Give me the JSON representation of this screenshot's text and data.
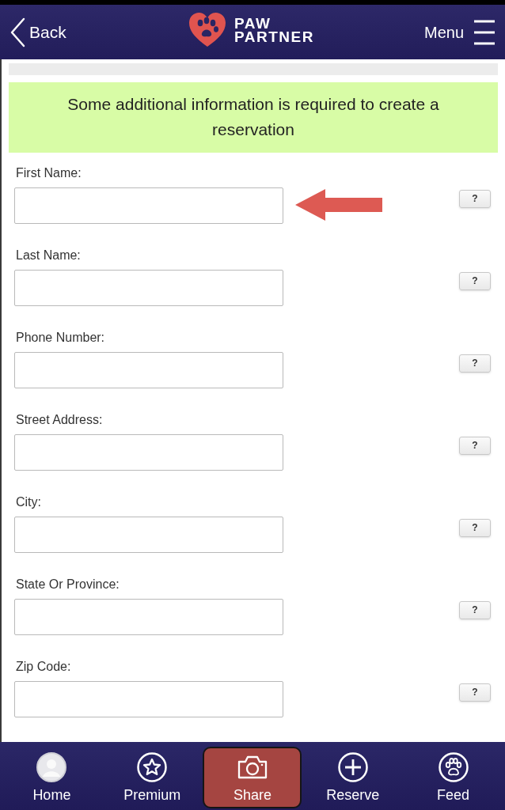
{
  "header": {
    "back": "Back",
    "logo_lines": [
      "PAW",
      "PARTNER"
    ],
    "menu": "Menu"
  },
  "notice": "Some additional information is required to create a reservation",
  "fields": [
    {
      "label": "First Name:",
      "help": "?",
      "arrow": true
    },
    {
      "label": "Last Name:",
      "help": "?",
      "arrow": false
    },
    {
      "label": "Phone Number:",
      "help": "?",
      "arrow": false
    },
    {
      "label": "Street Address:",
      "help": "?",
      "arrow": false
    },
    {
      "label": "City:",
      "help": "?",
      "arrow": false
    },
    {
      "label": "State Or Province:",
      "help": "?",
      "arrow": false
    },
    {
      "label": "Zip Code:",
      "help": "?",
      "arrow": false
    }
  ],
  "nav": [
    {
      "label": "Home",
      "kind": "avatar",
      "selected": false
    },
    {
      "label": "Premium",
      "kind": "star",
      "selected": false
    },
    {
      "label": "Share",
      "kind": "camera",
      "selected": true
    },
    {
      "label": "Reserve",
      "kind": "plus",
      "selected": false
    },
    {
      "label": "Feed",
      "kind": "paw",
      "selected": false
    }
  ]
}
